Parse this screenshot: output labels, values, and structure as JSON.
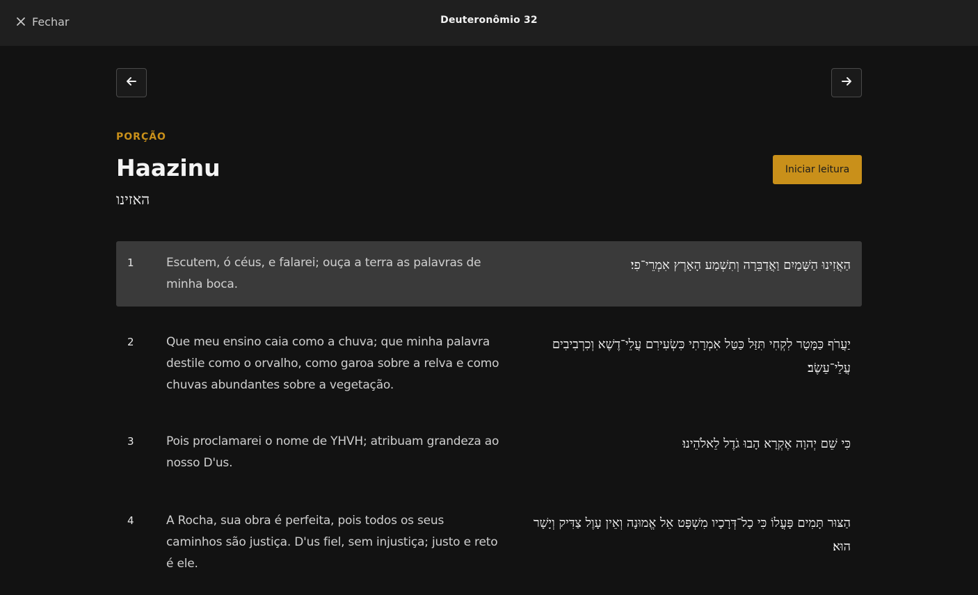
{
  "header": {
    "close_label": "Fechar",
    "title": "Deuteronômio 32"
  },
  "portion": {
    "overline": "PORÇÃO",
    "title": "Haazinu",
    "hebrew": "האזינו",
    "start_button": "Iniciar leitura"
  },
  "verses": [
    {
      "number": "1",
      "pt": "Escutem, ó céus, e falarei; ouça a terra as palavras de minha boca.",
      "he": "הַאֲזִינוּ הַשָּׁמַיִם וַאֲדַבֵּרָה וְתִשְׁמַע הָאָרֶץ אִמְרֵי־פִי׃"
    },
    {
      "number": "2",
      "pt": "Que meu ensino caia como a chuva; que minha palavra destile como o orvalho, como garoa sobre a relva e como chuvas abundantes sobre a vegetação.",
      "he": "יַעֲרֹף כַּמָּטָר לִקְחִי תִּזַּל כַּטַּל אִמְרָתִי כִּשְׂעִירִם עֲלֵי־דֶשֶׁא וְכִרְבִיבִים עֲלֵי־עֵשֶׂב׃"
    },
    {
      "number": "3",
      "pt": "Pois proclamarei o nome de YHVH; atribuam grandeza ao nosso D'us.",
      "he": "כִּי שֵׁם יְהוָה אֶקְרָא הָבוּ גֹדֶל לֵאלֹהֵינוּ׃"
    },
    {
      "number": "4",
      "pt": "A Rocha, sua obra é perfeita, pois todos os seus caminhos são justiça. D'us fiel, sem injustiça; justo e reto é ele.",
      "he": "הַצּוּר תָּמִים פָּעֳלוֹ כִּי כָל־דְּרָכָיו מִשְׁפָּט אֵל אֱמוּנָה וְאֵין עָוֶל צַדִּיק וְיָשָׁר הוּא׃"
    }
  ]
}
